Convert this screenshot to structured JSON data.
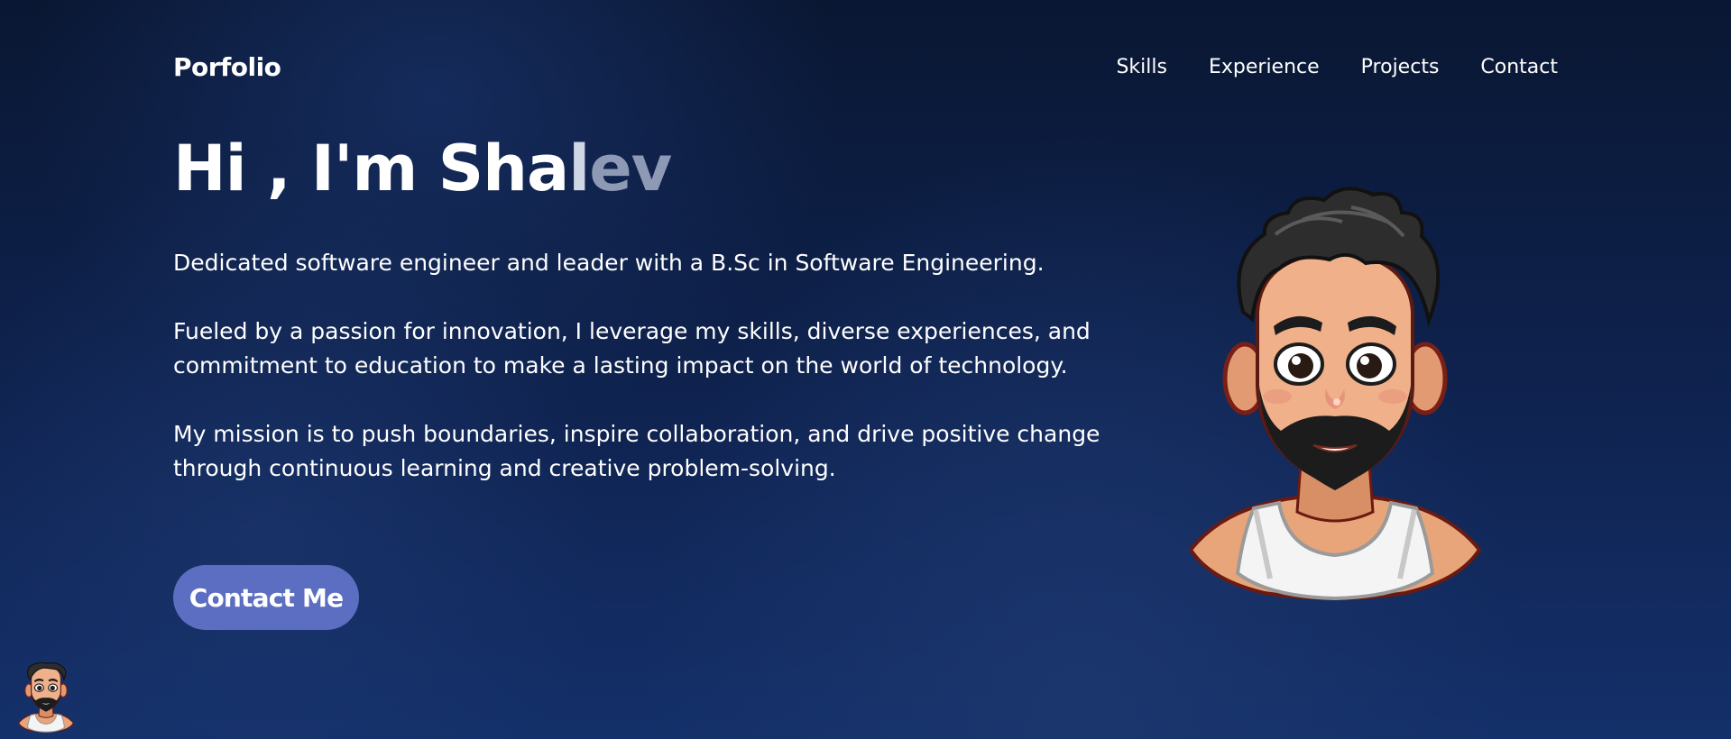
{
  "header": {
    "brand": "Porfolio",
    "nav": [
      "Skills",
      "Experience",
      "Projects",
      "Contact"
    ]
  },
  "hero": {
    "title_prefix": "Hi , I'm Sha",
    "title_fade_1": "l",
    "title_fade_2": "ev",
    "paragraphs": [
      "Dedicated software engineer and leader with a B.Sc in Software Engineering.",
      "Fueled by a passion for innovation, I leverage my skills, diverse experiences, and commitment to education to make a lasting impact on the world of technology.",
      "My mission is to push boundaries, inspire collaboration, and drive positive change through continuous learning and creative problem-solving."
    ],
    "cta_label": "Contact Me"
  },
  "icons": {
    "hero_avatar": "cartoon-avatar-icon",
    "floating_avatar": "cartoon-avatar-icon"
  },
  "colors": {
    "background": "#0f2350",
    "accent_button": "#5c6ec2",
    "text": "#ffffff"
  }
}
